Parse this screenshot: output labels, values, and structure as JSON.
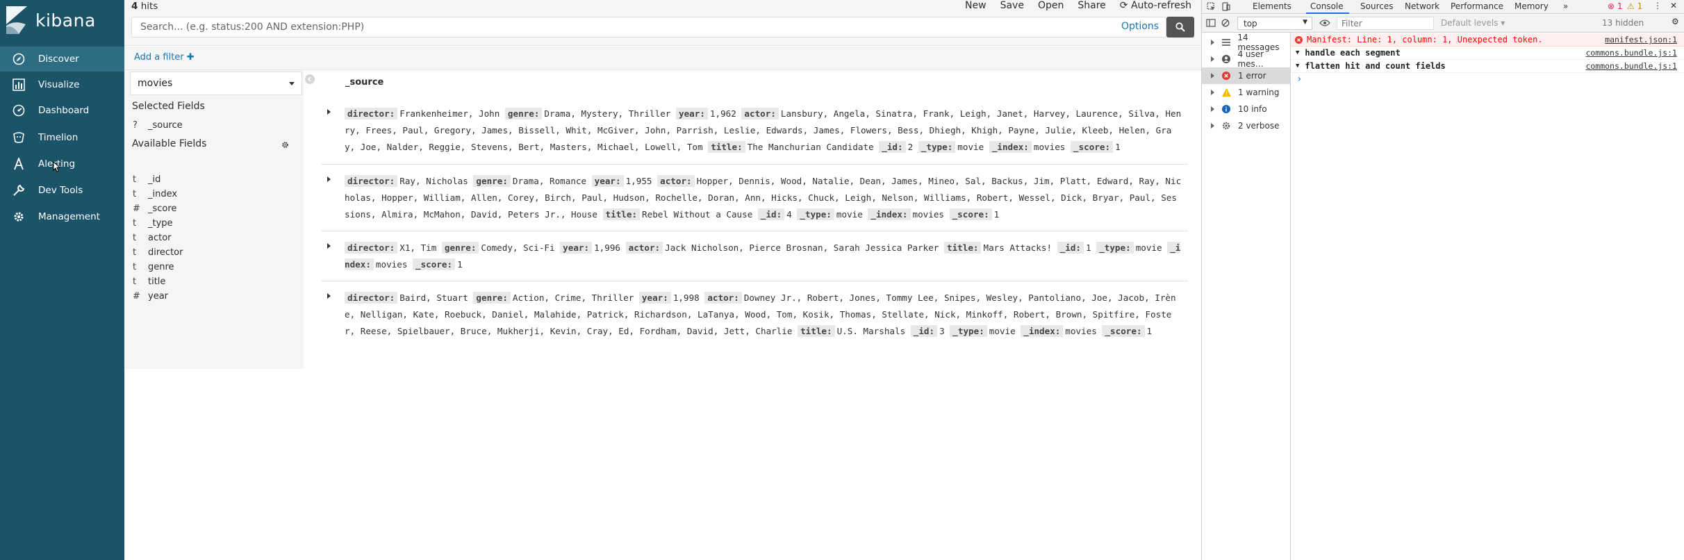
{
  "app": {
    "logo_text": "kibana"
  },
  "sidenav": {
    "items": [
      {
        "label": "Discover",
        "icon": "compass-icon"
      },
      {
        "label": "Visualize",
        "icon": "bar-chart-icon"
      },
      {
        "label": "Dashboard",
        "icon": "dashboard-icon"
      },
      {
        "label": "Timelion",
        "icon": "timelion-icon"
      },
      {
        "label": "Alerting",
        "icon": "alerting-icon"
      },
      {
        "label": "Dev Tools",
        "icon": "wrench-icon"
      },
      {
        "label": "Management",
        "icon": "gear-icon"
      }
    ]
  },
  "topbar": {
    "hits_count": "4",
    "hits_label": "hits",
    "menu": {
      "new": "New",
      "save": "Save",
      "open": "Open",
      "share": "Share",
      "auto_refresh": "Auto-refresh"
    },
    "query_placeholder": "Search... (e.g. status:200 AND extension:PHP)",
    "options": "Options"
  },
  "filterbar": {
    "add_filter": "Add a filter"
  },
  "field_sidebar": {
    "index_pattern": "movies",
    "selected_title": "Selected Fields",
    "selected": [
      {
        "type": "?",
        "name": "_source"
      }
    ],
    "available_title": "Available Fields",
    "available": [
      {
        "type": "t",
        "name": "_id"
      },
      {
        "type": "t",
        "name": "_index"
      },
      {
        "type": "#",
        "name": "_score"
      },
      {
        "type": "t",
        "name": "_type"
      },
      {
        "type": "t",
        "name": "actor"
      },
      {
        "type": "t",
        "name": "director"
      },
      {
        "type": "t",
        "name": "genre"
      },
      {
        "type": "t",
        "name": "title"
      },
      {
        "type": "#",
        "name": "year"
      }
    ]
  },
  "docs": {
    "column_header": "_source",
    "rows": [
      {
        "fields": [
          [
            "director:",
            "Frankenheimer, John"
          ],
          [
            "genre:",
            "Drama, Mystery, Thriller"
          ],
          [
            "year:",
            "1,962"
          ],
          [
            "actor:",
            "Lansbury, Angela, Sinatra, Frank, Leigh, Janet, Harvey, Laurence, Silva, Henry, Frees, Paul, Gregory, James, Bissell, Whit, McGiver, John, Parrish, Leslie, Edwards, James, Flowers, Bess, Dhiegh, Khigh, Payne, Julie, Kleeb, Helen, Gray, Joe, Nalder, Reggie, Stevens, Bert, Masters, Michael, Lowell, Tom"
          ],
          [
            "title:",
            "The Manchurian Candidate"
          ],
          [
            "_id:",
            "2"
          ],
          [
            "_type:",
            "movie"
          ],
          [
            "_index:",
            "movies"
          ],
          [
            "_score:",
            "1"
          ]
        ]
      },
      {
        "fields": [
          [
            "director:",
            "Ray, Nicholas"
          ],
          [
            "genre:",
            "Drama, Romance"
          ],
          [
            "year:",
            "1,955"
          ],
          [
            "actor:",
            "Hopper, Dennis, Wood, Natalie, Dean, James, Mineo, Sal, Backus, Jim, Platt, Edward, Ray, Nicholas, Hopper, William, Allen, Corey, Birch, Paul, Hudson, Rochelle, Doran, Ann, Hicks, Chuck, Leigh, Nelson, Williams, Robert, Wessel, Dick, Bryar, Paul, Sessions, Almira, McMahon, David, Peters Jr., House"
          ],
          [
            "title:",
            "Rebel Without a Cause"
          ],
          [
            "_id:",
            "4"
          ],
          [
            "_type:",
            "movie"
          ],
          [
            "_index:",
            "movies"
          ],
          [
            "_score:",
            "1"
          ]
        ]
      },
      {
        "fields": [
          [
            "director:",
            "X1, Tim"
          ],
          [
            "genre:",
            "Comedy, Sci-Fi"
          ],
          [
            "year:",
            "1,996"
          ],
          [
            "actor:",
            "Jack Nicholson, Pierce Brosnan, Sarah Jessica Parker"
          ],
          [
            "title:",
            "Mars Attacks!"
          ],
          [
            "_id:",
            "1"
          ],
          [
            "_type:",
            "movie"
          ],
          [
            "_index:",
            "movies"
          ],
          [
            "_score:",
            "1"
          ]
        ]
      },
      {
        "fields": [
          [
            "director:",
            "Baird, Stuart"
          ],
          [
            "genre:",
            "Action, Crime, Thriller"
          ],
          [
            "year:",
            "1,998"
          ],
          [
            "actor:",
            "Downey Jr., Robert, Jones, Tommy Lee, Snipes, Wesley, Pantoliano, Joe, Jacob, Irène, Nelligan, Kate, Roebuck, Daniel, Malahide, Patrick, Richardson, LaTanya, Wood, Tom, Kosik, Thomas, Stellate, Nick, Minkoff, Robert, Brown, Spitfire, Foster, Reese, Spielbauer, Bruce, Mukherji, Kevin, Cray, Ed, Fordham, David, Jett, Charlie"
          ],
          [
            "title:",
            "U.S. Marshals"
          ],
          [
            "_id:",
            "3"
          ],
          [
            "_type:",
            "movie"
          ],
          [
            "_index:",
            "movies"
          ],
          [
            "_score:",
            "1"
          ]
        ]
      }
    ]
  },
  "devtools": {
    "tabs": [
      "Elements",
      "Console",
      "Sources",
      "Network",
      "Performance",
      "Memory"
    ],
    "more_tabs": "»",
    "error_count": "1",
    "warning_count": "1",
    "context": "top",
    "filter_placeholder": "Filter",
    "levels": "Default levels",
    "hidden": "13 hidden",
    "sidebar": [
      {
        "label": "14 messages",
        "icon": "list-icon"
      },
      {
        "label": "4 user mes…",
        "icon": "user-icon"
      },
      {
        "label": "1 error",
        "icon": "error-icon"
      },
      {
        "label": "1 warning",
        "icon": "warning-icon"
      },
      {
        "label": "10 info",
        "icon": "info-icon"
      },
      {
        "label": "2 verbose",
        "icon": "verbose-icon"
      }
    ],
    "logs": [
      {
        "text": "Manifest: Line: 1, column: 1, Unexpected token.",
        "source": "manifest.json:1",
        "level": "error"
      },
      {
        "text": "handle each segment",
        "source": "commons.bundle.js:1",
        "level": "group"
      },
      {
        "text": "flatten hit and count fields",
        "source": "commons.bundle.js:1",
        "level": "group"
      }
    ],
    "prompt": "›"
  },
  "colors": {
    "nav_bg": "#1b5468",
    "nav_active": "#2d6c82",
    "link": "#1977af",
    "error": "#ff0000"
  }
}
